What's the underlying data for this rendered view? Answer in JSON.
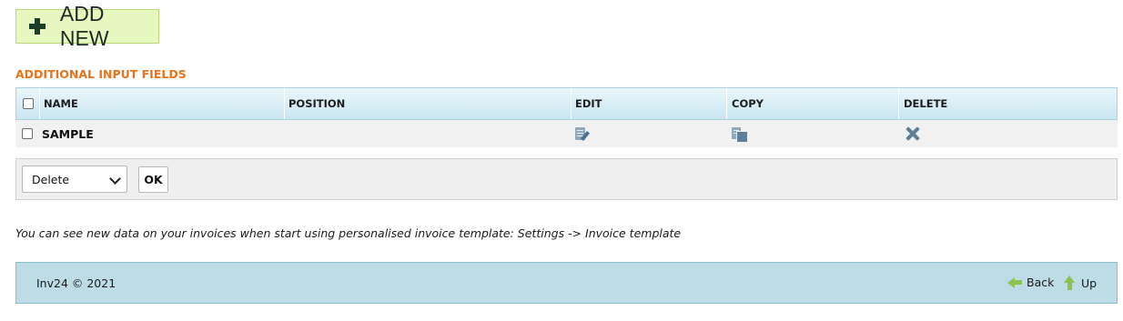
{
  "toolbar": {
    "add_new_label": "ADD NEW"
  },
  "section": {
    "title": "ADDITIONAL INPUT FIELDS"
  },
  "table": {
    "columns": [
      "NAME",
      "POSITION",
      "EDIT",
      "COPY",
      "DELETE"
    ],
    "rows": [
      {
        "name": "SAMPLE",
        "position": ""
      }
    ]
  },
  "bulk_actions": {
    "selected": "Delete",
    "ok_label": "OK"
  },
  "note": "You can see new data on your invoices when start using personalised invoice template: Settings -> Invoice template",
  "footer": {
    "copyright": "Inv24 © 2021",
    "back_label": "Back",
    "up_label": "Up"
  },
  "colors": {
    "accent_orange": "#e8731e",
    "add_button_bg": "#e6f8c0",
    "header_blue": "#c9e6f1",
    "footer_blue": "#bddce6",
    "arrow_green": "#8cc24f"
  },
  "icons": [
    "plus-icon",
    "edit-icon",
    "copy-icon",
    "delete-icon",
    "back-arrow-icon",
    "up-arrow-icon"
  ]
}
